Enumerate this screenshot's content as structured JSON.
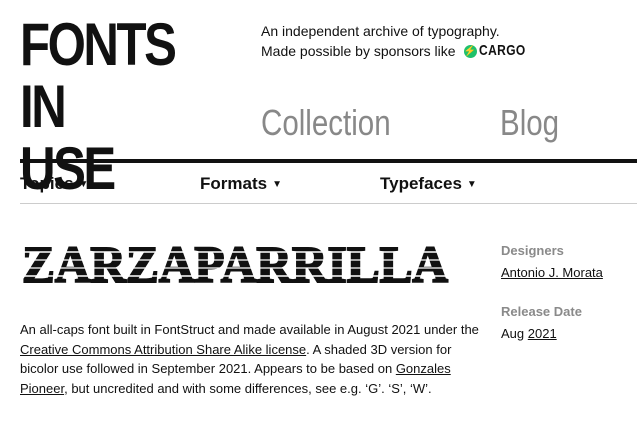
{
  "header": {
    "logo_line1": "FONTS",
    "logo_line2": "IN USE",
    "tagline": "An independent archive of typography.",
    "sponsor_text": "Made possible by sponsors like",
    "sponsor_name": "CARGO",
    "sponsor_icon": "lightning-icon",
    "sponsor_color": "#1fc16b"
  },
  "nav": {
    "collection": "Collection",
    "blog": "Blog"
  },
  "subnav": {
    "topics": "Topics",
    "formats": "Formats",
    "typefaces": "Typefaces",
    "caret": "▼"
  },
  "typeface": {
    "specimen_text": "ZARZAPARRILLA",
    "description": {
      "part1": "An all-caps font built in FontStruct and made available in August 2021 under the ",
      "link1": "Creative Commons Attribution Share Alike license",
      "part2": ". A shaded 3D version for bicolor use followed in September 2021. Appears to be based on ",
      "link2": "Gonzales Pioneer",
      "part3": ", but uncredited and with some differences, see e.g. ‘G’. ‘S’, ‘W’."
    }
  },
  "meta": {
    "designers_label": "Designers",
    "designer_name": "Antonio J. Morata",
    "release_label": "Release Date",
    "release_month": "Aug",
    "release_year": "2021"
  }
}
